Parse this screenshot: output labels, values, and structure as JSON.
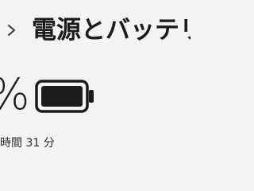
{
  "header": {
    "title": "電源とバッテリー"
  },
  "battery": {
    "percent_text": "%",
    "charge_level": 1.0,
    "icon": "battery-full-icon",
    "time_remaining": "時間 31 分"
  }
}
